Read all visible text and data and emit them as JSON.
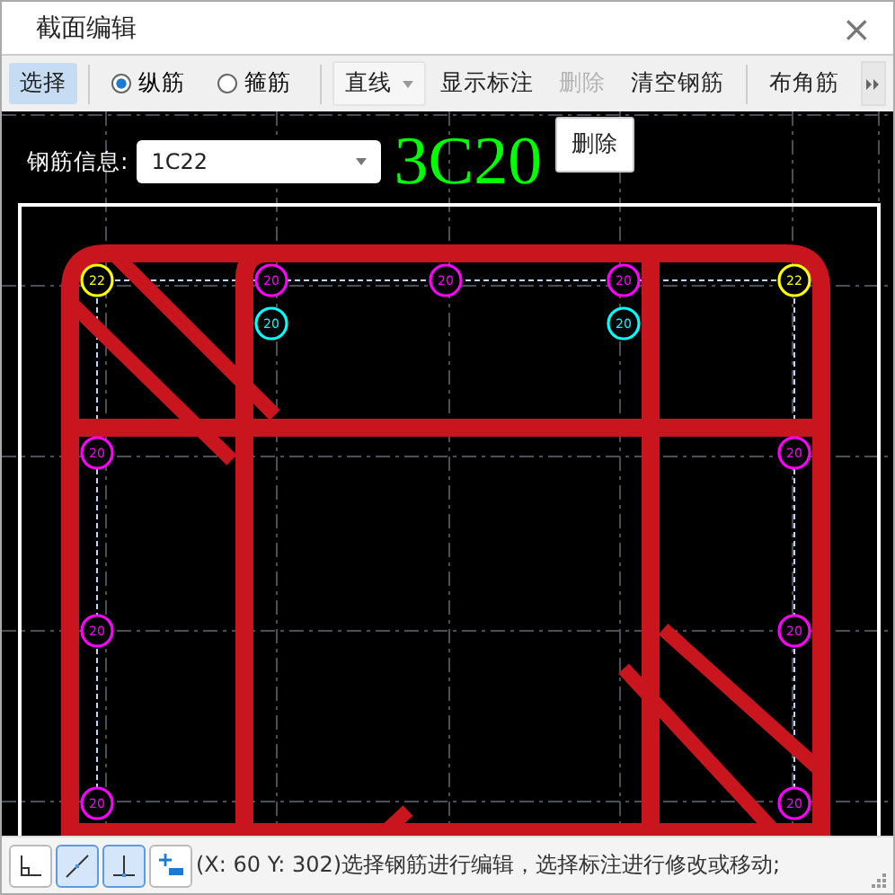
{
  "window": {
    "title": "截面编辑",
    "close": "×"
  },
  "toolbar_groups": [
    [
      {
        "kind": "button",
        "label": "选择",
        "selected": true,
        "disabled": false
      }
    ],
    [
      {
        "kind": "radio",
        "label": "纵筋",
        "checked": true
      },
      {
        "kind": "radio",
        "label": "箍筋",
        "checked": false
      }
    ],
    [
      {
        "kind": "dropdown",
        "label": "直线"
      },
      {
        "kind": "button",
        "label": "显示标注",
        "selected": false,
        "disabled": false
      },
      {
        "kind": "button",
        "label": "删除",
        "selected": false,
        "disabled": true
      },
      {
        "kind": "button",
        "label": "清空钢筋",
        "selected": false,
        "disabled": false
      }
    ],
    [
      {
        "kind": "button",
        "label": "布角筋",
        "selected": false,
        "disabled": false
      }
    ]
  ],
  "canvas": {
    "info_label": "钢筋信息:",
    "info_value": "1C22",
    "annotation": "3C20",
    "popup_menu": [
      "删除"
    ],
    "bars": [
      {
        "label": "22",
        "color": "#ffff00"
      },
      {
        "label": "20",
        "color": "#ff00ff"
      },
      {
        "label": "20",
        "color": "#ff00ff"
      },
      {
        "label": "20",
        "color": "#ff00ff"
      },
      {
        "label": "22",
        "color": "#ffff00"
      },
      {
        "label": "20",
        "color": "#00ffff"
      },
      {
        "label": "20",
        "color": "#00ffff"
      },
      {
        "label": "20",
        "color": "#ff00ff"
      },
      {
        "label": "20",
        "color": "#ff00ff"
      },
      {
        "label": "20",
        "color": "#ff00ff"
      },
      {
        "label": "20",
        "color": "#ff00ff"
      },
      {
        "label": "20",
        "color": "#ff00ff"
      },
      {
        "label": "20",
        "color": "#ff00ff"
      }
    ]
  },
  "snap_tools": [
    {
      "kind": "corner",
      "selected": false
    },
    {
      "kind": "slope",
      "selected": true
    },
    {
      "kind": "perpendicular",
      "selected": true
    },
    {
      "kind": "add",
      "selected": false
    }
  ],
  "status_bar": {
    "text": "(X: 60 Y: 302)选择钢筋进行编辑，选择标注进行修改或移动;"
  }
}
